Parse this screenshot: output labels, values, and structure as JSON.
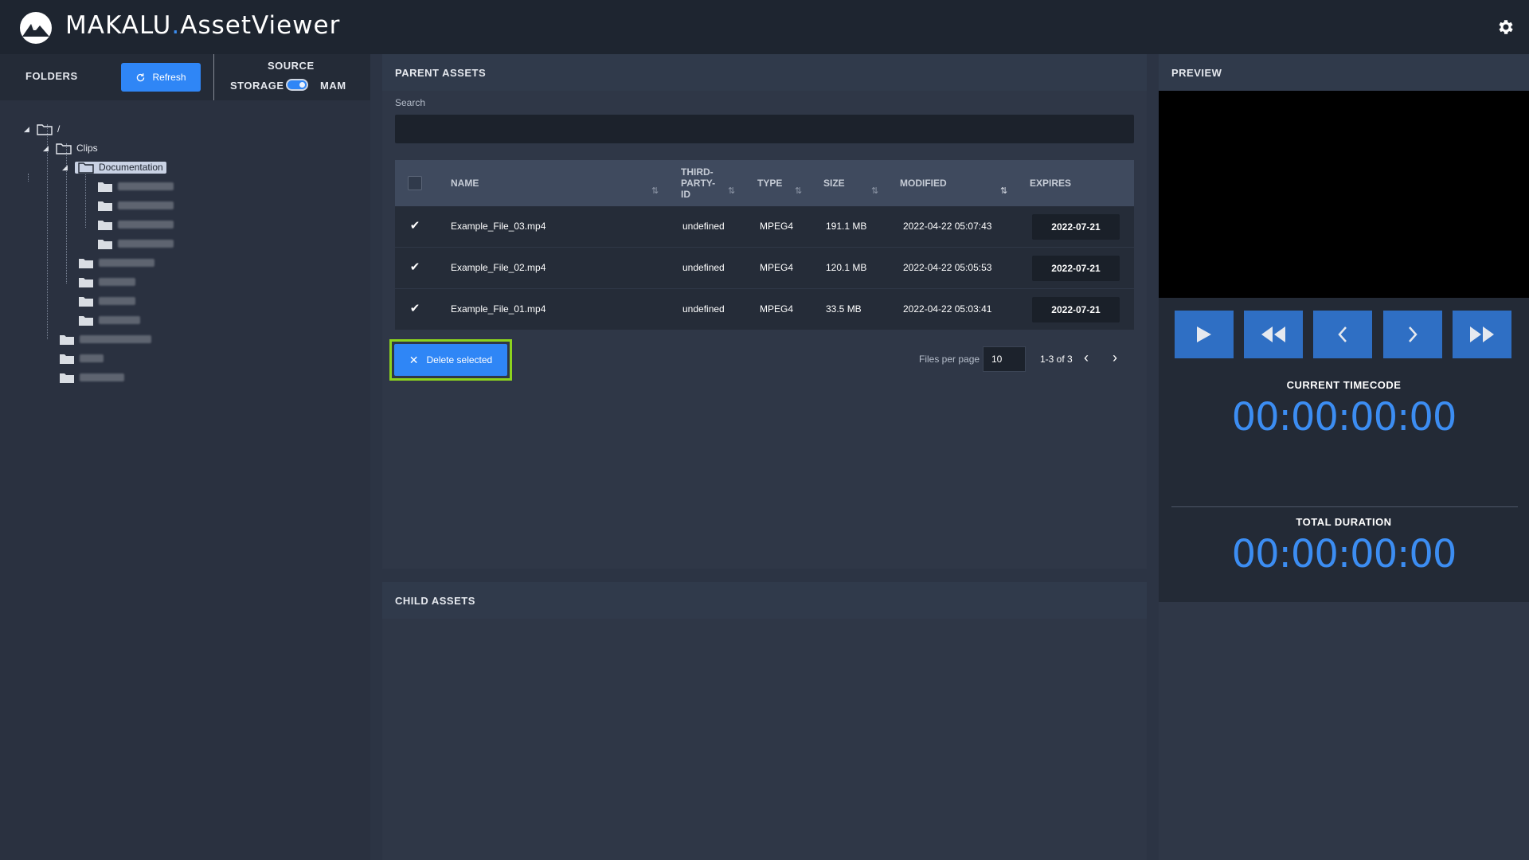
{
  "app": {
    "brand_main": "MAKALU",
    "brand_dot": ".",
    "brand_sub": "AssetViewer",
    "accent_color": "#2f86f6"
  },
  "folders_panel": {
    "title": "FOLDERS",
    "refresh_label": "Refresh",
    "source_title": "SOURCE",
    "storage_label": "STORAGE",
    "mam_label": "MAM",
    "tree": {
      "root_label": "/",
      "clips_label": "Clips",
      "documentation_label": "Documentation"
    }
  },
  "parent_assets": {
    "title": "PARENT ASSETS",
    "search_label": "Search",
    "search_value": "",
    "columns": {
      "name": "NAME",
      "third_party_1": "THIRD-",
      "third_party_2": "PARTY-",
      "third_party_3": "ID",
      "type": "TYPE",
      "size": "SIZE",
      "modified": "MODIFIED",
      "expires": "EXPIRES"
    },
    "rows": [
      {
        "name": "Example_File_03.mp4",
        "third_party_id": "undefined",
        "type": "MPEG4",
        "size": "191.1 MB",
        "modified": "2022-04-22 05:07:43",
        "expires": "2022-07-21",
        "checked": true
      },
      {
        "name": "Example_File_02.mp4",
        "third_party_id": "undefined",
        "type": "MPEG4",
        "size": "120.1 MB",
        "modified": "2022-04-22 05:05:53",
        "expires": "2022-07-21",
        "checked": true
      },
      {
        "name": "Example_File_01.mp4",
        "third_party_id": "undefined",
        "type": "MPEG4",
        "size": "33.5 MB",
        "modified": "2022-04-22 05:03:41",
        "expires": "2022-07-21",
        "checked": true
      }
    ],
    "delete_label": "Delete selected",
    "files_per_page_label": "Files per page",
    "files_per_page_value": "10",
    "range_text": "1-3 of 3"
  },
  "child_assets": {
    "title": "CHILD ASSETS"
  },
  "preview": {
    "title": "PREVIEW",
    "current_timecode_label": "CURRENT TIMECODE",
    "current_timecode": "00:00:00:00",
    "total_duration_label": "TOTAL DURATION",
    "total_duration": "00:00:00:00"
  }
}
